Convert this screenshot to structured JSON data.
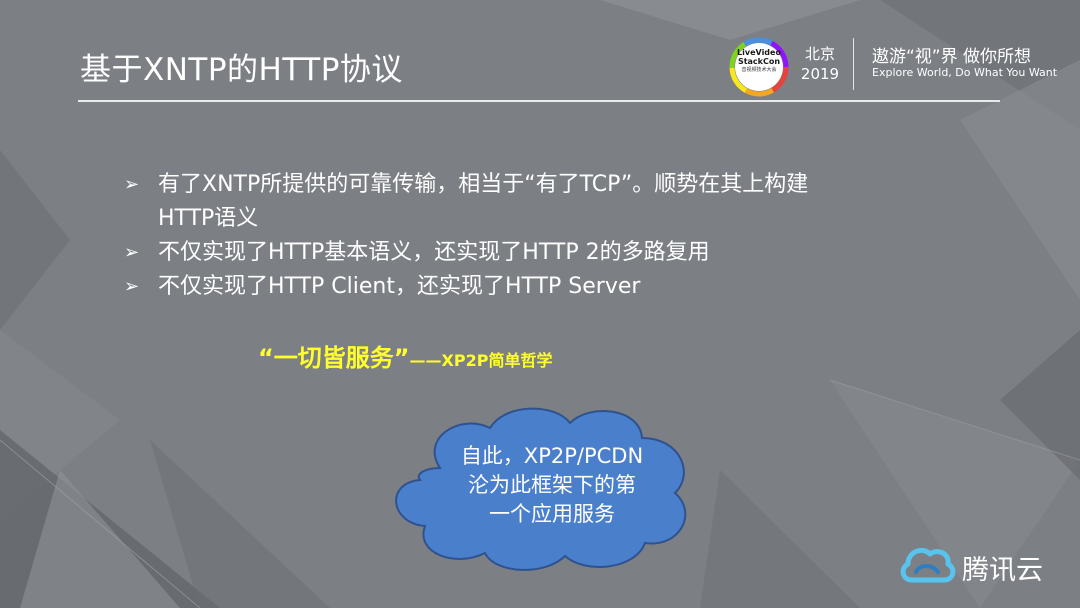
{
  "slide": {
    "title": "基于XNTP的HTTP协议"
  },
  "conference": {
    "logo_line1": "LiveVideo",
    "logo_line2": "StackCon",
    "logo_sub": "音视频技术大会",
    "city": "北京",
    "year": "2019",
    "slogan_cn": "遨游“视”界 做你所想",
    "slogan_en": "Explore World, Do What You Want"
  },
  "bullets": [
    {
      "text": "有了XNTP所提供的可靠传输，相当于“有了TCP”。顺势在其上构建HTTP语义"
    },
    {
      "text": "不仅实现了HTTP基本语义，还实现了HTTP 2的多路复用"
    },
    {
      "text": "不仅实现了HTTP Client，还实现了HTTP Server"
    }
  ],
  "quote": {
    "main": "“一切皆服务”",
    "source": "——XP2P简单哲学"
  },
  "callout": {
    "lines": [
      "自此，XP2P/PCDN",
      "沦为此框架下的第",
      "一个应用服务"
    ]
  },
  "brand": {
    "name": "腾讯云",
    "icon": "tencent-cloud-icon"
  },
  "colors": {
    "background": "#7c7f84",
    "quote": "#ffff2b",
    "callout_fill": "#4a7fcc",
    "callout_stroke": "#2f528f",
    "brand_icon": "#58c4ee"
  }
}
